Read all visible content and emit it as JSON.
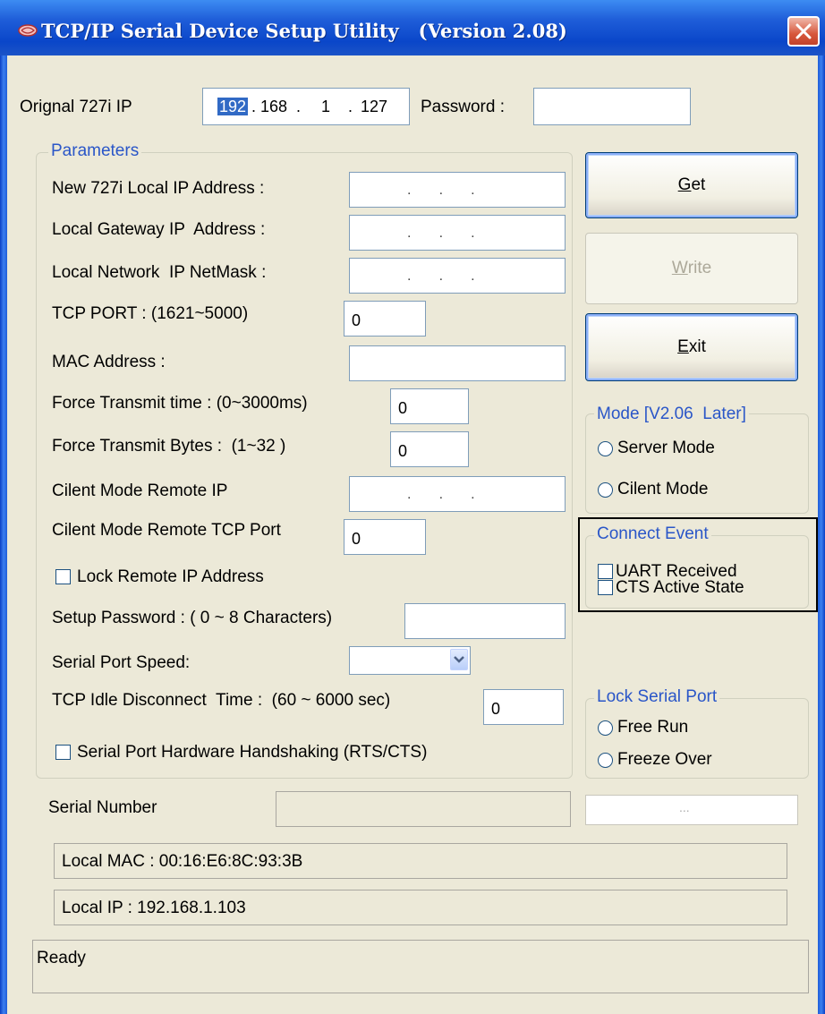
{
  "window": {
    "title": "TCP/IP Serial Device Setup Utility   (Version 2.08)"
  },
  "top": {
    "orig_ip_label": "Orignal 727i IP",
    "ip_octets": [
      "192",
      "168",
      "1",
      "127"
    ],
    "password_label": "Password :",
    "password_value": ""
  },
  "parameters": {
    "group_label": "Parameters",
    "new_ip_label": "New 727i Local IP Address :",
    "gateway_label": "Local Gateway IP  Address :",
    "netmask_label": "Local Network  IP NetMask :",
    "tcp_port_label": "TCP PORT : (1621~5000)",
    "tcp_port_value": "0",
    "mac_label": "MAC Address :",
    "mac_value": "",
    "force_time_label": "Force Transmit time : (0~3000ms)",
    "force_time_value": "0",
    "force_bytes_label": "Force Transmit Bytes :  (1~32 )",
    "force_bytes_value": "0",
    "client_ip_label": "Cilent Mode Remote IP",
    "client_port_label": "Cilent Mode Remote TCP Port",
    "client_port_value": "0",
    "lock_remote_label": "Lock Remote IP Address",
    "setup_pwd_label": "Setup Password : ( 0 ~ 8 Characters)",
    "setup_pwd_value": "",
    "serial_speed_label": "Serial Port Speed:",
    "serial_speed_value": "",
    "idle_label": "TCP Idle Disconnect  Time :  (60 ~ 6000 sec)",
    "idle_value": "0",
    "hw_handshake_label": "Serial Port Hardware Handshaking (RTS/CTS)"
  },
  "buttons": {
    "get_mnemonic": "G",
    "get_rest": "et",
    "write_mnemonic": "W",
    "write_rest": "rite",
    "exit_mnemonic": "E",
    "exit_rest": "xit"
  },
  "mode": {
    "group_label": "Mode [V2.06  Later]",
    "server_label": "Server Mode",
    "client_label": "Cilent Mode"
  },
  "connect_event": {
    "group_label": "Connect Event",
    "uart_label": "UART Received",
    "cts_label": "CTS Active State"
  },
  "lock_serial": {
    "group_label": "Lock Serial Port",
    "free_run_label": "Free Run",
    "freeze_over_label": "Freeze Over"
  },
  "bottom": {
    "serial_number_label": "Serial Number",
    "serial_number_value": "",
    "side_box_value": "...",
    "local_mac": "Local MAC : 00:16:E6:8C:93:3B",
    "local_ip": "Local IP  : 192.168.1.103",
    "status": "Ready"
  },
  "colors": {
    "title_bar": "#1f5ed9",
    "window_bg": "#ece9d8",
    "group_title": "#2a56c8",
    "selection": "#316ac5"
  }
}
